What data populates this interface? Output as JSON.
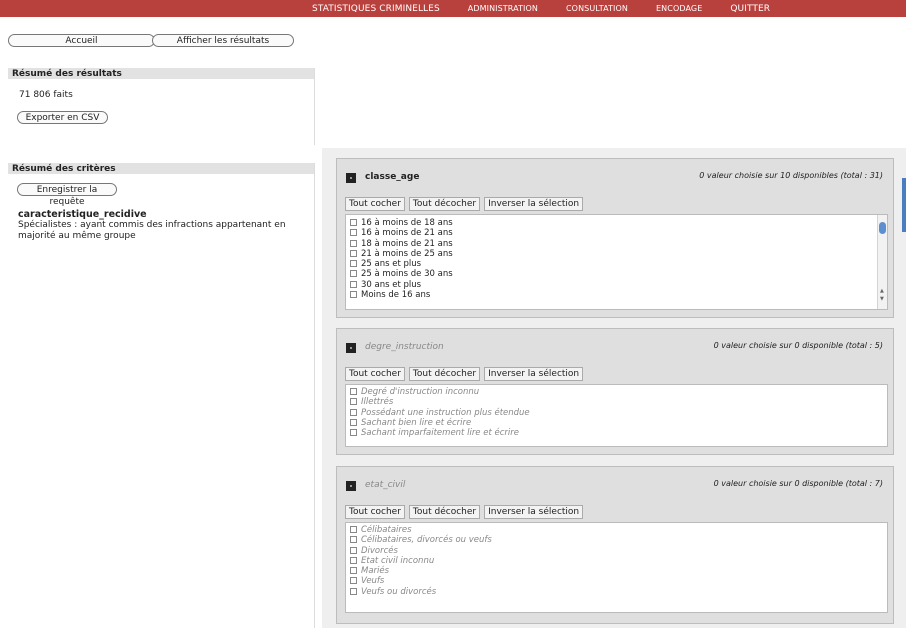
{
  "nav": {
    "items": [
      "Statistiques criminelles",
      "Administration",
      "Consultation",
      "Encodage",
      "Quitter"
    ]
  },
  "buttons": {
    "accueil": "Accueil",
    "afficher": "Afficher les résultats",
    "export": "Exporter en CSV",
    "save": "Enregistrer la requête"
  },
  "results": {
    "title": "Résumé des résultats",
    "count": "71 806 faits"
  },
  "criteria": {
    "title": "Résumé des critères",
    "name": "caracteristique_recidive",
    "desc": "Spécialistes : ayant commis des infractions appartenant en majorité au même groupe"
  },
  "actions": {
    "check_all": "Tout cocher",
    "uncheck_all": "Tout décocher",
    "invert": "Inverser la sélection"
  },
  "boxes": [
    {
      "name": "classe_age",
      "summary": "0 valeur choisie sur 10 disponibles (total : 31)",
      "items": [
        "16 à moins de 18 ans",
        "16 à moins de 21 ans",
        "18 à moins de 21 ans",
        "21 à moins de 25 ans",
        "25 ans et plus",
        "25 à moins de 30 ans",
        "30 ans et plus",
        "Moins de 16 ans"
      ]
    },
    {
      "name": "degre_instruction",
      "summary": "0 valeur choisie sur 0 disponible (total : 5)",
      "items": [
        "Degré d'instruction inconnu",
        "Illettrés",
        "Possédant une instruction plus étendue",
        "Sachant bien lire et écrire",
        "Sachant imparfaitement lire et écrire"
      ]
    },
    {
      "name": "etat_civil",
      "summary": "0 valeur choisie sur 0 disponible (total : 7)",
      "items": [
        "Célibataires",
        "Célibataires, divorcés ou veufs",
        "Divorcés",
        "Etat civil inconnu",
        "Mariés",
        "Veufs",
        "Veufs ou divorcés"
      ]
    }
  ],
  "colors": {
    "topbar": "#b8403d",
    "scroll_thumb": "#5b8fcf"
  }
}
